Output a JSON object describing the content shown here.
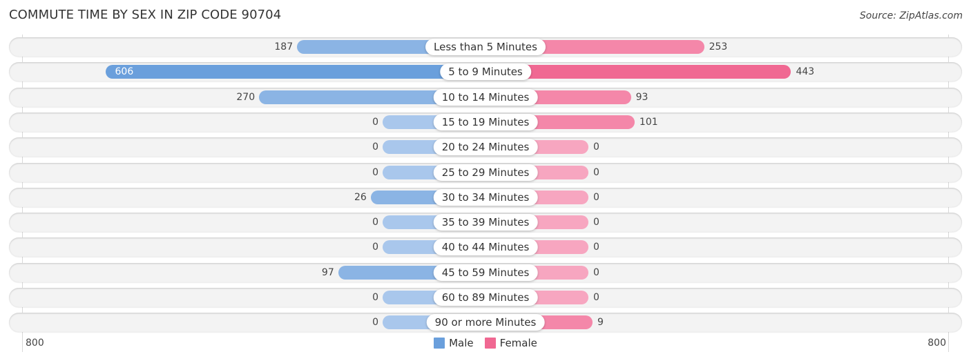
{
  "title": "COMMUTE TIME BY SEX IN ZIP CODE 90704",
  "source": "Source: ZipAtlas.com",
  "colors": {
    "male": "#6a9fdc",
    "female": "#f06892",
    "male_light": "#a9c7ec",
    "female_light": "#f7a6c0"
  },
  "chart_data": {
    "type": "bar",
    "orientation": "horizontal-diverging",
    "title": "COMMUTE TIME BY SEX IN ZIP CODE 90704",
    "categories": [
      "Less than 5 Minutes",
      "5 to 9 Minutes",
      "10 to 14 Minutes",
      "15 to 19 Minutes",
      "20 to 24 Minutes",
      "25 to 29 Minutes",
      "30 to 34 Minutes",
      "35 to 39 Minutes",
      "40 to 44 Minutes",
      "45 to 59 Minutes",
      "60 to 89 Minutes",
      "90 or more Minutes"
    ],
    "series": [
      {
        "name": "Male",
        "values": [
          187,
          606,
          270,
          0,
          0,
          0,
          26,
          0,
          0,
          97,
          0,
          0
        ]
      },
      {
        "name": "Female",
        "values": [
          253,
          443,
          93,
          101,
          0,
          0,
          0,
          0,
          0,
          0,
          0,
          9
        ]
      }
    ],
    "xlim": [
      800,
      800
    ],
    "tick_labels": {
      "left": "800",
      "right": "800"
    },
    "legend": {
      "position": "bottom-center",
      "entries": [
        "Male",
        "Female"
      ]
    },
    "grid": false
  }
}
